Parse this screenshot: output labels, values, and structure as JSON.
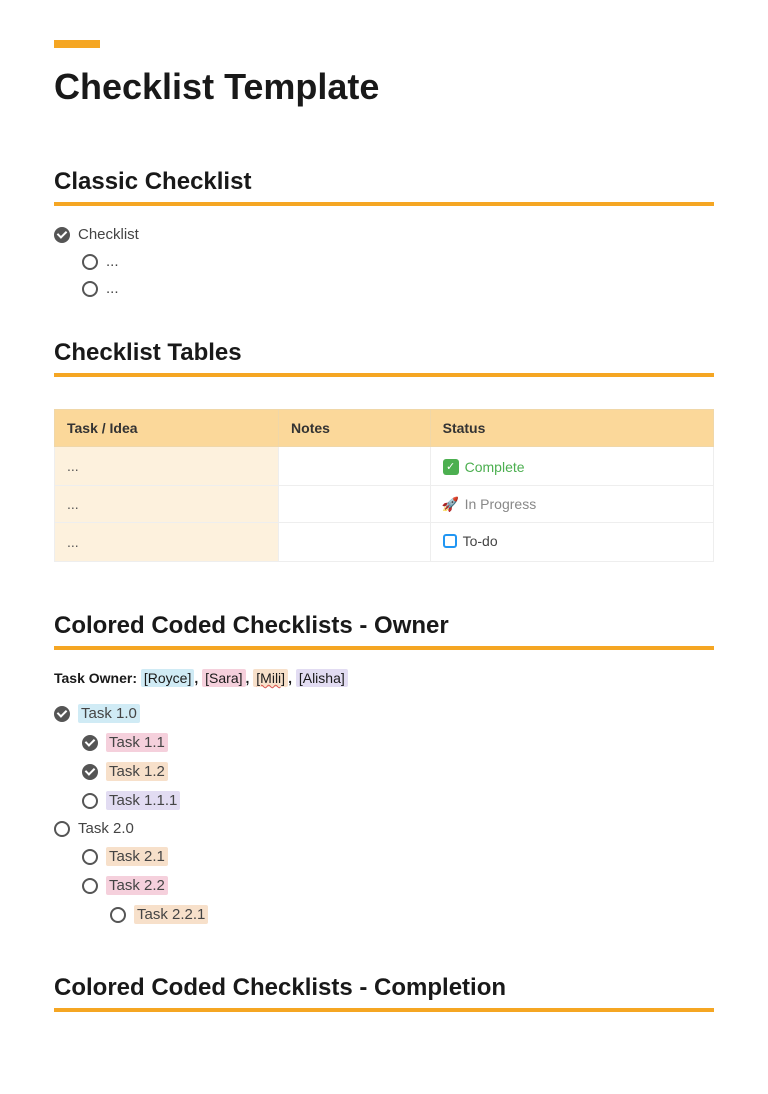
{
  "title": "Checklist Template",
  "sections": {
    "classic": {
      "heading": "Classic Checklist",
      "items": [
        {
          "label": "Checklist",
          "done": true,
          "indent": 0
        },
        {
          "label": "...",
          "done": false,
          "indent": 1
        },
        {
          "label": "...",
          "done": false,
          "indent": 1
        }
      ]
    },
    "tables": {
      "heading": "Checklist Tables",
      "columns": [
        "Task / Idea",
        "Notes",
        "Status"
      ],
      "rows": [
        {
          "task": "...",
          "notes": "",
          "status": {
            "kind": "complete",
            "text": "Complete"
          }
        },
        {
          "task": "...",
          "notes": "",
          "status": {
            "kind": "progress",
            "text": "In Progress"
          }
        },
        {
          "task": "...",
          "notes": "",
          "status": {
            "kind": "todo",
            "text": "To-do"
          }
        }
      ]
    },
    "owner": {
      "heading": "Colored Coded Checklists - Owner",
      "owner_label": "Task Owner:",
      "owners": [
        {
          "name": "[Royce]",
          "color": "blue"
        },
        {
          "name": "[Sara]",
          "color": "pink"
        },
        {
          "name": "[Mili]",
          "color": "orange",
          "underlined": true
        },
        {
          "name": "[Alisha]",
          "color": "purple"
        }
      ],
      "items": [
        {
          "label": "Task 1.0",
          "done": true,
          "indent": 0,
          "color": "blue"
        },
        {
          "label": "Task 1.1",
          "done": true,
          "indent": 1,
          "color": "pink"
        },
        {
          "label": "Task 1.2",
          "done": true,
          "indent": 1,
          "color": "orange"
        },
        {
          "label": "Task 1.1.1",
          "done": false,
          "indent": 1,
          "color": "purple"
        },
        {
          "label": "Task 2.0",
          "done": false,
          "indent": 0,
          "color": ""
        },
        {
          "label": "Task 2.1",
          "done": false,
          "indent": 1,
          "color": "orange"
        },
        {
          "label": "Task 2.2",
          "done": false,
          "indent": 1,
          "color": "pink"
        },
        {
          "label": "Task 2.2.1",
          "done": false,
          "indent": 2,
          "color": "orange"
        }
      ]
    },
    "completion": {
      "heading": "Colored Coded Checklists - Completion"
    }
  }
}
